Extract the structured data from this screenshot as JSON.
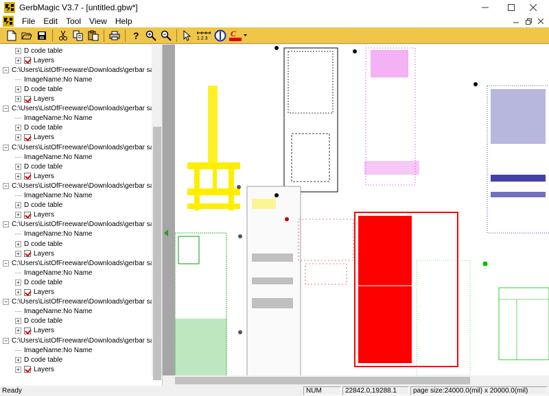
{
  "window": {
    "title": "GerbMagic V3.7 - [untitled.gbw*]"
  },
  "menu": {
    "items": [
      "File",
      "Edit",
      "Tool",
      "View",
      "Help"
    ]
  },
  "toolbar": {
    "buttons": [
      "new-file-icon",
      "open-folder-icon",
      "save-icon",
      "cut-icon",
      "copy-icon",
      "paste-icon",
      "print-icon",
      "help-icon",
      "zoom-in-icon",
      "zoom-out-icon",
      "select-arrow-icon",
      "ruler-icon",
      "circle-tool-icon",
      "color-picker-icon"
    ],
    "ruler_label": "1 2 3",
    "color_label": "C"
  },
  "tree": {
    "rows": [
      {
        "type": "child",
        "label": "D code table"
      },
      {
        "type": "layers",
        "label": "Layers"
      },
      {
        "type": "file",
        "label": "C:\\Users\\ListOfFreeware\\Downloads\\gerbar samp"
      },
      {
        "type": "image",
        "label": "ImageName:No Name"
      },
      {
        "type": "child",
        "label": "D code table"
      },
      {
        "type": "layers",
        "label": "Layers"
      },
      {
        "type": "file",
        "label": "C:\\Users\\ListOfFreeware\\Downloads\\gerbar samp"
      },
      {
        "type": "image",
        "label": "ImageName:No Name"
      },
      {
        "type": "child",
        "label": "D code table"
      },
      {
        "type": "layers",
        "label": "Layers"
      },
      {
        "type": "file",
        "label": "C:\\Users\\ListOfFreeware\\Downloads\\gerbar samp"
      },
      {
        "type": "image",
        "label": "ImageName:No Name"
      },
      {
        "type": "child",
        "label": "D code table"
      },
      {
        "type": "layers",
        "label": "Layers"
      },
      {
        "type": "file",
        "label": "C:\\Users\\ListOfFreeware\\Downloads\\gerbar samp"
      },
      {
        "type": "image",
        "label": "ImageName:No Name"
      },
      {
        "type": "child",
        "label": "D code table"
      },
      {
        "type": "layers",
        "label": "Layers"
      },
      {
        "type": "file",
        "label": "C:\\Users\\ListOfFreeware\\Downloads\\gerbar samp"
      },
      {
        "type": "image",
        "label": "ImageName:No Name"
      },
      {
        "type": "child",
        "label": "D code table"
      },
      {
        "type": "layers",
        "label": "Layers"
      },
      {
        "type": "file",
        "label": "C:\\Users\\ListOfFreeware\\Downloads\\gerbar samp"
      },
      {
        "type": "image",
        "label": "ImageName:No Name"
      },
      {
        "type": "child",
        "label": "D code table"
      },
      {
        "type": "layers",
        "label": "Layers"
      },
      {
        "type": "file",
        "label": "C:\\Users\\ListOfFreeware\\Downloads\\gerbar samp"
      },
      {
        "type": "image",
        "label": "ImageName:No Name"
      },
      {
        "type": "child",
        "label": "D code table"
      },
      {
        "type": "layers",
        "label": "Layers"
      },
      {
        "type": "file",
        "label": "C:\\Users\\ListOfFreeware\\Downloads\\gerbar samp"
      },
      {
        "type": "image",
        "label": "ImageName:No Name"
      },
      {
        "type": "child",
        "label": "D code table"
      },
      {
        "type": "layers",
        "label": "Layers"
      }
    ]
  },
  "colors": {
    "toolbar": "#f0c64a",
    "yellow_layer": "#ffee00",
    "magenta_layer": "#e020e0",
    "red_layer": "#ff0000",
    "green_layer": "#00a000",
    "navy_layer": "#101090",
    "black_layer": "#000000"
  },
  "status": {
    "ready": "Ready",
    "num": "NUM",
    "coords": "22842.0,19288.1",
    "page_size": "page size:24000.0(mil) x 20000.0(mil)"
  }
}
